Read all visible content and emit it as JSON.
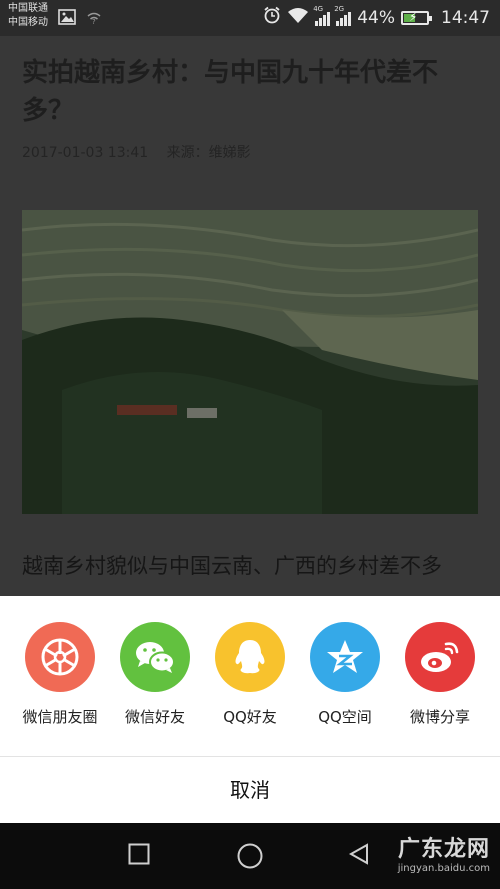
{
  "status_bar": {
    "carrier_1": "中国联通",
    "carrier_2": "中国移动",
    "net_tag_1": "4G",
    "net_tag_2": "2G",
    "battery": "44%",
    "time": "14:47"
  },
  "article": {
    "title": "实拍越南乡村：与中国九十年代差不多？",
    "date": "2017-01-03 13:41",
    "source": "来源：维娣影",
    "paragraph": "越南乡村貌似与中国云南、广西的乡村差不多"
  },
  "share_sheet": {
    "items": [
      {
        "label": "微信朋友圈",
        "icon": "moments-shutter-icon",
        "color": "#f06a55"
      },
      {
        "label": "微信好友",
        "icon": "wechat-icon",
        "color": "#62c13f"
      },
      {
        "label": "QQ好友",
        "icon": "qq-penguin-icon",
        "color": "#f8c22d"
      },
      {
        "label": "QQ空间",
        "icon": "qzone-star-icon",
        "color": "#35a9e8"
      },
      {
        "label": "微博分享",
        "icon": "weibo-icon",
        "color": "#e53b3b"
      }
    ],
    "cancel_label": "取消"
  },
  "watermark": {
    "main": "广东龙网",
    "sub": "jingyan.baidu.com"
  },
  "colors": {
    "overlay_dim": "#383838",
    "sheet_bg": "#ffffff",
    "navbar_bg": "#0c0c0c"
  }
}
